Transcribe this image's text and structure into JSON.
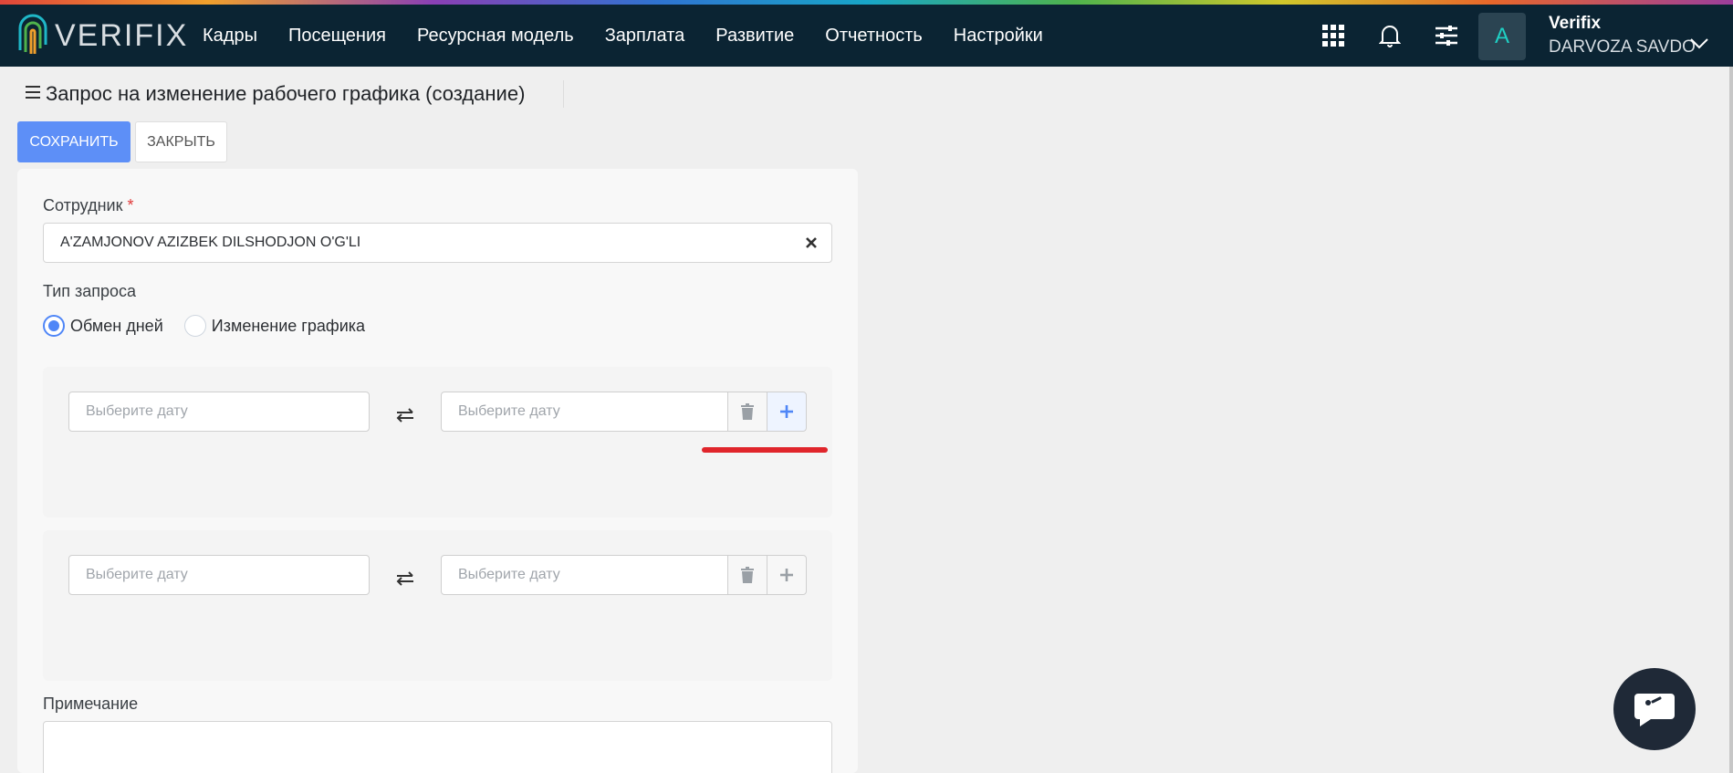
{
  "app": {
    "logo_text": "VERIFIX"
  },
  "nav": {
    "items": [
      "Кадры",
      "Посещения",
      "Ресурсная модель",
      "Зарплата",
      "Развитие",
      "Отчетность",
      "Настройки"
    ]
  },
  "user": {
    "avatar_letter": "A",
    "name": "Verifix",
    "org": "DARVOZA SAVDO"
  },
  "page": {
    "title": "Запрос на изменение рабочего графика (создание)",
    "save_label": "СОХРАНИТЬ",
    "close_label": "ЗАКРЫТЬ"
  },
  "form": {
    "employee_label": "Сотрудник",
    "required_mark": "*",
    "employee_value": "A'ZAMJONOV AZIZBEK DILSHODJON O'G'LI",
    "request_type_label": "Тип запроса",
    "request_types": [
      {
        "label": "Обмен дней",
        "checked": true
      },
      {
        "label": "Изменение графика",
        "checked": false
      }
    ],
    "date_placeholder": "Выберите дату",
    "note_label": "Примечание"
  },
  "colors": {
    "primary": "#5d8ff7",
    "navbar": "#0b2433",
    "accent_teal": "#1fd0c4",
    "highlight": "#e0252b"
  }
}
